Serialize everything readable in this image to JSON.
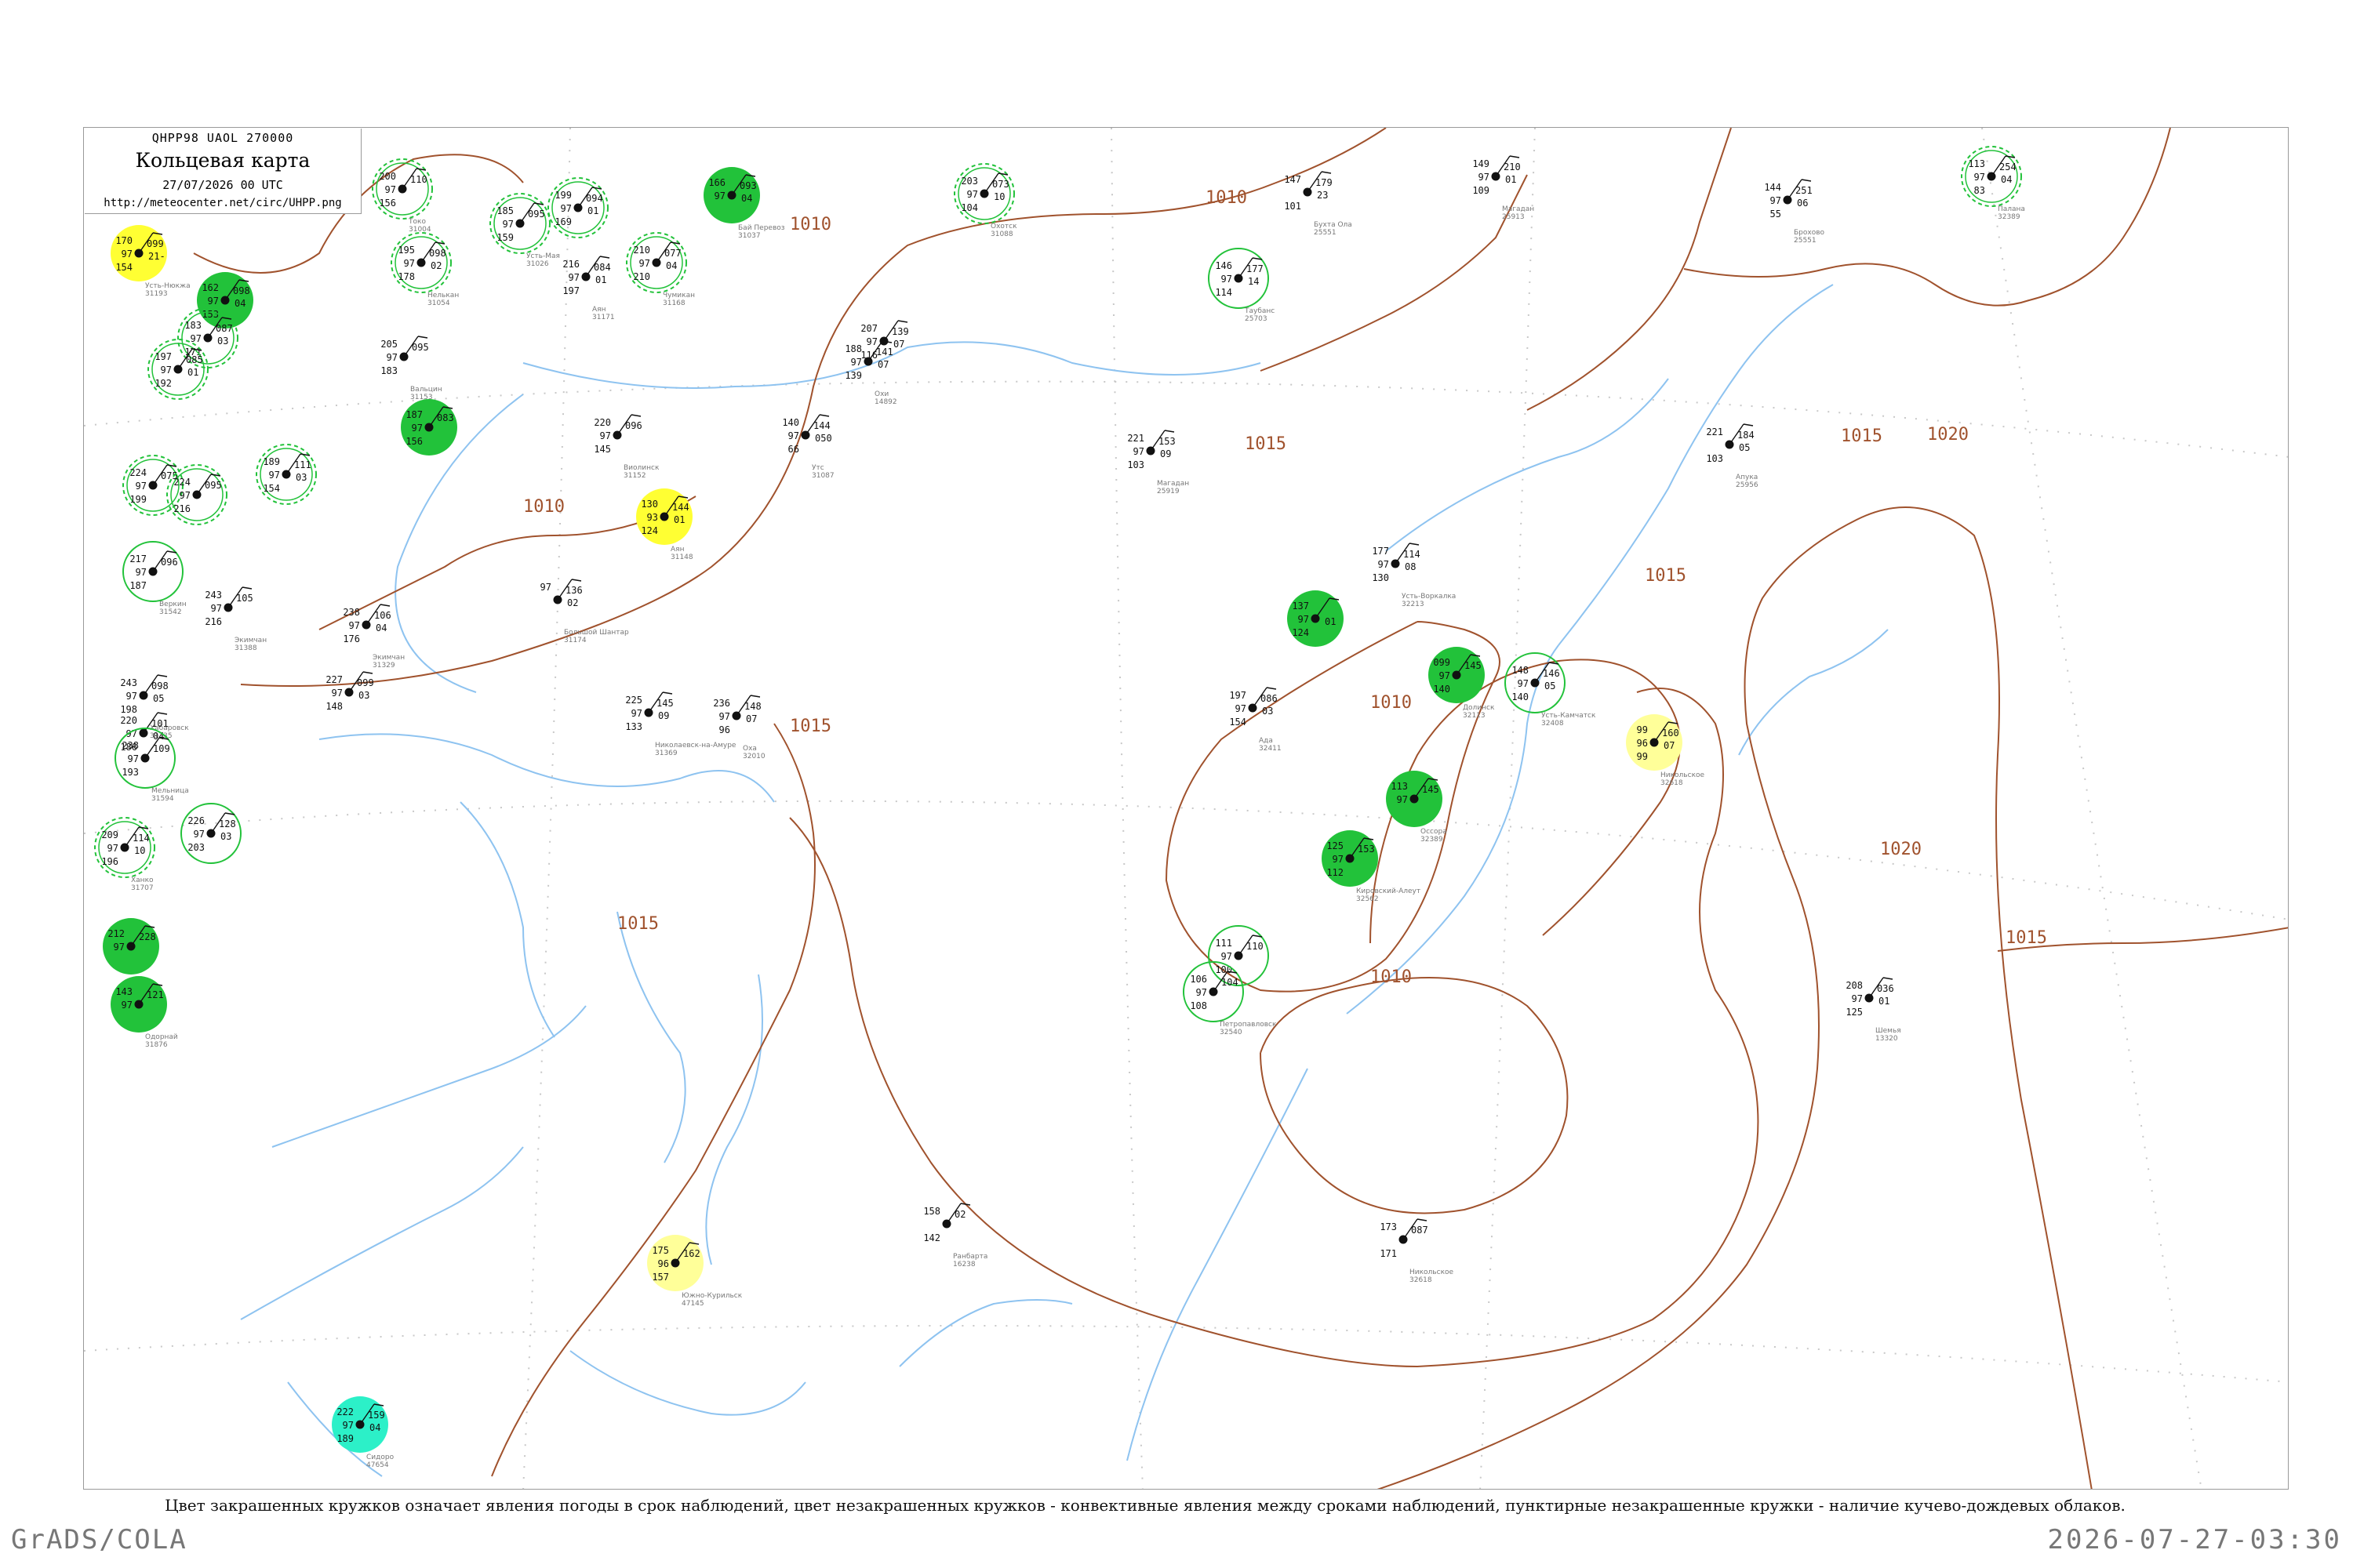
{
  "legend": {
    "code": "QHPP98  UAOL  270000",
    "title": "Кольцевая карта",
    "date": "27/07/2026 00 UTC",
    "url": "http://meteocenter.net/circ/UHPP.png"
  },
  "caption": "Цвет закрашенных кружков означает явления погоды в срок наблюдений, цвет незакрашенных кружков - конвективные явления между сроками наблюдений, пунктирные незакрашенные кружки - наличие кучево-дождевых облаков.",
  "footer": {
    "left": "GrADS/COLA",
    "right": "2026-07-27-03:30"
  },
  "colors": {
    "isobar": "#a0522d",
    "water": "#8ec3f0",
    "fill_rain": "#22c23a",
    "fill_fog": "#ffff33",
    "fill_haze": "#ffff99",
    "fill_shower": "#2cf0c8",
    "ring": "#22c23a"
  },
  "isobar_labels": [
    "1010",
    "1010",
    "1010",
    "1010",
    "1010",
    "1015",
    "1015",
    "1015",
    "1015",
    "1015",
    "1020",
    "1020",
    "1015"
  ],
  "stations": [
    {
      "id": "s1",
      "top": "170",
      "left": "97",
      "bottom": "154",
      "right_top": "099",
      "right_mid": "21-",
      "marker": "fill-yellow",
      "name": "Усть-Нюкжа",
      "code": "31193"
    },
    {
      "id": "s2",
      "top": "200",
      "left": "97",
      "bottom": "156",
      "right_top": "110",
      "right_mid": "",
      "marker": "ring-dashed",
      "name": "Токо",
      "code": "31004"
    },
    {
      "id": "s3",
      "top": "185",
      "left": "97",
      "bottom": "159",
      "right_top": "095",
      "right_mid": "",
      "marker": "ring-dashed",
      "name": "Усть-Мая",
      "code": "31026"
    },
    {
      "id": "s4",
      "top": "199",
      "left": "97",
      "bottom": "169",
      "right_top": "094",
      "right_mid": "01",
      "marker": "ring-dashed",
      "name": "",
      "code": ""
    },
    {
      "id": "s5",
      "top": "166",
      "left": "97",
      "bottom": "",
      "right_top": "093",
      "right_mid": "04",
      "marker": "fill-green",
      "name": "Бай Перевоз",
      "code": "31037"
    },
    {
      "id": "s6",
      "top": "203",
      "left": "97",
      "bottom": "104",
      "right_top": "073",
      "right_mid": "10",
      "marker": "ring-dashed",
      "name": "Охотск",
      "code": "31088"
    },
    {
      "id": "s7",
      "top": "147",
      "left": "",
      "bottom": "101",
      "right_top": "179",
      "right_mid": "23",
      "marker": "none",
      "name": "Бухта Ола",
      "code": "25551"
    },
    {
      "id": "s8",
      "top": "149",
      "left": "97",
      "bottom": "109",
      "right_top": "210",
      "right_mid": "01",
      "marker": "none",
      "name": "Магадан",
      "code": "25913"
    },
    {
      "id": "s9",
      "top": "144",
      "left": "97",
      "bottom": "55",
      "right_top": "251",
      "right_mid": "06",
      "marker": "none",
      "name": "Брохово",
      "code": "25551"
    },
    {
      "id": "s10",
      "top": "113",
      "left": "97",
      "bottom": "83",
      "right_top": "254",
      "right_mid": "04",
      "marker": "ring-dashed",
      "name": "Палана",
      "code": "32389"
    },
    {
      "id": "s11",
      "top": "195",
      "left": "97",
      "bottom": "178",
      "right_top": "098",
      "right_mid": "02",
      "marker": "ring-dashed",
      "name": "Нелькан",
      "code": "31054"
    },
    {
      "id": "s12",
      "top": "216",
      "left": "97",
      "bottom": "197",
      "right_top": "084",
      "right_mid": "01",
      "marker": "none",
      "name": "Аян",
      "code": "31171"
    },
    {
      "id": "s13",
      "top": "210",
      "left": "97",
      "bottom": "210",
      "right_top": "077",
      "right_mid": "04",
      "marker": "ring-dashed",
      "name": "Чумикан",
      "code": "31168"
    },
    {
      "id": "s14",
      "top": "162",
      "left": "97",
      "bottom": "153",
      "right_top": "098",
      "right_mid": "04",
      "marker": "fill-green",
      "name": "",
      "code": ""
    },
    {
      "id": "s15",
      "top": "183",
      "left": "97",
      "bottom": "171",
      "right_top": "087",
      "right_mid": "03",
      "marker": "ring-dashed",
      "name": "",
      "code": ""
    },
    {
      "id": "s16",
      "top": "197",
      "left": "97",
      "bottom": "192",
      "right_top": "085",
      "right_mid": "01",
      "marker": "ring-dashed",
      "name": "",
      "code": ""
    },
    {
      "id": "s17",
      "top": "205",
      "left": "97",
      "bottom": "183",
      "right_top": "095",
      "right_mid": "",
      "marker": "none",
      "name": "Вальцин",
      "code": "31153"
    },
    {
      "id": "s18",
      "top": "146",
      "left": "97",
      "bottom": "114",
      "right_top": "177",
      "right_mid": "14",
      "marker": "ring-green",
      "name": "Таубанс",
      "code": "25703"
    },
    {
      "id": "s19",
      "top": "207",
      "left": "97",
      "bottom": "116",
      "right_top": "139",
      "right_mid": "07",
      "marker": "none",
      "name": "",
      "code": ""
    },
    {
      "id": "s20",
      "top": "188",
      "left": "97",
      "bottom": "139",
      "right_top": "141",
      "right_mid": "07",
      "marker": "none",
      "name": "Охи",
      "code": "14892"
    },
    {
      "id": "s21",
      "top": "187",
      "left": "97",
      "bottom": "156",
      "right_top": "083",
      "right_mid": "",
      "marker": "fill-green",
      "name": "",
      "code": ""
    },
    {
      "id": "s22",
      "top": "220",
      "left": "97",
      "bottom": "145",
      "right_top": "096",
      "right_mid": "",
      "marker": "none",
      "name": "Виолинск",
      "code": "31152"
    },
    {
      "id": "s23",
      "top": "140",
      "left": "97",
      "bottom": "66",
      "right_top": "144",
      "right_mid": "050",
      "marker": "none",
      "name": "Утс",
      "code": "31087"
    },
    {
      "id": "s24",
      "top": "221",
      "left": "97",
      "bottom": "103",
      "right_top": "153",
      "right_mid": "09",
      "marker": "none",
      "name": "Магадан",
      "code": "25919"
    },
    {
      "id": "s25",
      "top": "221",
      "left": "",
      "bottom": "103",
      "right_top": "184",
      "right_mid": "05",
      "marker": "none",
      "name": "Апука",
      "code": "25956"
    },
    {
      "id": "s26",
      "top": "224",
      "left": "97",
      "bottom": "199",
      "right_top": "075",
      "right_mid": "",
      "marker": "ring-dashed",
      "name": "",
      "code": ""
    },
    {
      "id": "s27",
      "top": "224",
      "left": "97",
      "bottom": "216",
      "right_top": "095",
      "right_mid": "",
      "marker": "ring-dashed",
      "name": "",
      "code": ""
    },
    {
      "id": "s28",
      "top": "189",
      "left": "97",
      "bottom": "154",
      "right_top": "111",
      "right_mid": "03",
      "marker": "ring-dashed",
      "name": "",
      "code": ""
    },
    {
      "id": "s29",
      "top": "130",
      "left": "93",
      "bottom": "124",
      "right_top": "144",
      "right_mid": "01",
      "marker": "fill-yellow",
      "name": "Аян",
      "code": "31148"
    },
    {
      "id": "s30",
      "top": "217",
      "left": "97",
      "bottom": "187",
      "right_top": "096",
      "right_mid": "",
      "marker": "ring-green",
      "name": "Веркин",
      "code": "31542"
    },
    {
      "id": "s31",
      "top": "177",
      "left": "97",
      "bottom": "130",
      "right_top": "114",
      "right_mid": "08",
      "marker": "none",
      "name": "Усть-Воркалка",
      "code": "32213"
    },
    {
      "id": "s32",
      "top": "97",
      "left": "",
      "bottom": "",
      "right_top": "136",
      "right_mid": "02",
      "marker": "none",
      "name": "Большой Шантар",
      "code": "31174"
    },
    {
      "id": "s33",
      "top": "243",
      "left": "97",
      "bottom": "216",
      "right_top": "105",
      "right_mid": "",
      "marker": "none",
      "name": "Экимчан",
      "code": "31388"
    },
    {
      "id": "s34",
      "top": "238",
      "left": "97",
      "bottom": "176",
      "right_top": "106",
      "right_mid": "04",
      "marker": "none",
      "name": "Экимчан",
      "code": "31329"
    },
    {
      "id": "s35",
      "top": "137",
      "left": "97",
      "bottom": "124",
      "right_top": "",
      "right_mid": "01",
      "marker": "fill-green",
      "name": "",
      "code": ""
    },
    {
      "id": "s36",
      "top": "099",
      "left": "97",
      "bottom": "140",
      "right_top": "145",
      "right_mid": "",
      "marker": "fill-green",
      "name": "Долинск",
      "code": "32113"
    },
    {
      "id": "s37",
      "top": "148",
      "left": "97",
      "bottom": "140",
      "right_top": "146",
      "right_mid": "05",
      "marker": "ring-green",
      "name": "Усть-Камчатск",
      "code": "32408"
    },
    {
      "id": "s38",
      "top": "99",
      "left": "96",
      "bottom": "99",
      "right_top": "160",
      "right_mid": "07",
      "marker": "fill-lightyellow",
      "name": "Никольское",
      "code": "32618"
    },
    {
      "id": "s39",
      "top": "197",
      "left": "97",
      "bottom": "154",
      "right_top": "086",
      "right_mid": "03",
      "marker": "none",
      "name": "Ада",
      "code": "32411"
    },
    {
      "id": "s40",
      "top": "243",
      "left": "97",
      "bottom": "198",
      "right_top": "098",
      "right_mid": "05",
      "marker": "none",
      "name": "Хабаровск",
      "code": "31735"
    },
    {
      "id": "s41",
      "top": "220",
      "left": "97",
      "bottom": "186",
      "right_top": "101",
      "right_mid": "04",
      "marker": "none",
      "name": "",
      "code": ""
    },
    {
      "id": "s42",
      "top": "238",
      "left": "97",
      "bottom": "193",
      "right_top": "109",
      "right_mid": "",
      "marker": "ring-green",
      "name": "Мельница",
      "code": "31594"
    },
    {
      "id": "s43",
      "top": "227",
      "left": "97",
      "bottom": "148",
      "right_top": "099",
      "right_mid": "03",
      "marker": "none",
      "name": "",
      "code": ""
    },
    {
      "id": "s44",
      "top": "225",
      "left": "97",
      "bottom": "133",
      "right_top": "145",
      "right_mid": "09",
      "marker": "none",
      "name": "Николаевск-на-Амуре",
      "code": "31369"
    },
    {
      "id": "s45",
      "top": "236",
      "left": "97",
      "bottom": "96",
      "right_top": "148",
      "right_mid": "07",
      "marker": "none",
      "name": "Оха",
      "code": "32010"
    },
    {
      "id": "s46",
      "top": "113",
      "left": "97",
      "bottom": "",
      "right_top": "145",
      "right_mid": "",
      "marker": "fill-green",
      "name": "Оссора",
      "code": "32389"
    },
    {
      "id": "s47",
      "top": "125",
      "left": "97",
      "bottom": "112",
      "right_top": "153",
      "right_mid": "",
      "marker": "fill-green",
      "name": "Кировский-Алеут",
      "code": "32562"
    },
    {
      "id": "s48",
      "top": "111",
      "left": "97",
      "bottom": "100",
      "right_top": "110",
      "right_mid": "",
      "marker": "ring-green",
      "name": "",
      "code": ""
    },
    {
      "id": "s49",
      "top": "106",
      "left": "97",
      "bottom": "108",
      "right_top": "104",
      "right_mid": "",
      "marker": "ring-green",
      "name": "Петропавловск",
      "code": "32540"
    },
    {
      "id": "s50",
      "top": "158",
      "left": "",
      "bottom": "142",
      "right_top": "02",
      "right_mid": "",
      "marker": "none",
      "name": "Ранбарта",
      "code": "16238"
    },
    {
      "id": "s51",
      "top": "173",
      "left": "",
      "bottom": "171",
      "right_top": "087",
      "right_mid": "",
      "marker": "none",
      "name": "Никольское",
      "code": "32618"
    },
    {
      "id": "s52",
      "top": "208",
      "left": "97",
      "bottom": "125",
      "right_top": "036",
      "right_mid": "01",
      "marker": "none",
      "name": "Шемья",
      "code": "13320"
    },
    {
      "id": "s53",
      "top": "209",
      "left": "97",
      "bottom": "196",
      "right_top": "114",
      "right_mid": "10",
      "marker": "ring-dashed",
      "name": "Ханко",
      "code": "31707"
    },
    {
      "id": "s54",
      "top": "226",
      "left": "97",
      "bottom": "203",
      "right_top": "128",
      "right_mid": "03",
      "marker": "ring-green",
      "name": "",
      "code": ""
    },
    {
      "id": "s55",
      "top": "212",
      "left": "97",
      "bottom": "",
      "right_top": "228",
      "right_mid": "",
      "marker": "fill-green",
      "name": "",
      "code": ""
    },
    {
      "id": "s56",
      "top": "143",
      "left": "97",
      "bottom": "",
      "right_top": "121",
      "right_mid": "",
      "marker": "fill-green",
      "name": "Одорнай",
      "code": "31876"
    },
    {
      "id": "s57",
      "top": "175",
      "left": "96",
      "bottom": "157",
      "right_top": "162",
      "right_mid": "",
      "marker": "fill-lightyellow",
      "name": "Южно-Курильск",
      "code": "47145"
    },
    {
      "id": "s58",
      "top": "222",
      "left": "97",
      "bottom": "189",
      "right_top": "159",
      "right_mid": "04",
      "marker": "fill-cyan",
      "name": "Сидоро",
      "code": "47654"
    }
  ]
}
